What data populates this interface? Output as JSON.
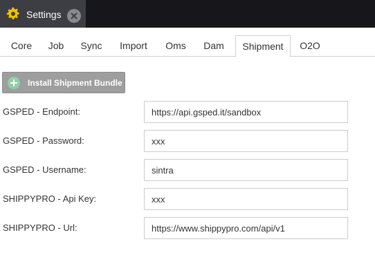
{
  "window": {
    "title": "Settings",
    "icon": "gear-icon",
    "close_icon": "close-icon"
  },
  "tabs": [
    {
      "label": "Core"
    },
    {
      "label": "Job"
    },
    {
      "label": "Sync"
    },
    {
      "label": "Import"
    },
    {
      "label": "Oms"
    },
    {
      "label": "Dam"
    },
    {
      "label": "Shipment"
    },
    {
      "label": "O2O"
    }
  ],
  "active_tab": "Shipment",
  "install_button": {
    "label": "Install Shipment Bundle",
    "icon": "plus-circle-icon"
  },
  "fields": [
    {
      "label": "GSPED - Endpoint:",
      "value": "https://api.gsped.it/sandbox"
    },
    {
      "label": "GSPED - Password:",
      "value": "xxx"
    },
    {
      "label": "GSPED - Username:",
      "value": "sintra"
    },
    {
      "label": "SHIPPYPRO - Api Key:",
      "value": "xxx"
    },
    {
      "label": "SHIPPYPRO - Url:",
      "value": "https://www.shippypro.com/api/v1"
    }
  ],
  "colors": {
    "titlebar": "#16161b",
    "window_tab": "#3d3d44",
    "gear": "#f2c200",
    "button": "#9e9e9e",
    "plus": "#8fd0a6"
  }
}
